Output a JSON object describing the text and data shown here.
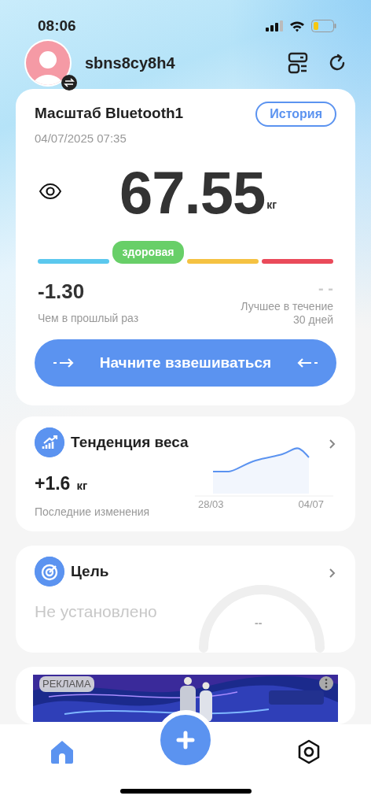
{
  "status_bar": {
    "time": "08:06"
  },
  "profile": {
    "username": "sbns8cy8h4"
  },
  "scale_card": {
    "title": "Масштаб Bluetooth1",
    "history_button": "История",
    "timestamp": "04/07/2025 07:35",
    "weight": "67.55",
    "unit": "кг",
    "status_label": "здоровая",
    "segments": [
      {
        "color": "#5bc8ee",
        "selected": false
      },
      {
        "color": "#68cf68",
        "selected": true
      },
      {
        "color": "#f5c242",
        "selected": false
      },
      {
        "color": "#ea4a5a",
        "selected": false
      }
    ],
    "change": "-1.30",
    "change_label": "Чем в прошлый раз",
    "best": "- -",
    "best_label": "Лучшее в течение 30 дней",
    "weigh_button": "Начните взвешиваться"
  },
  "trend_card": {
    "title": "Тенденция веса",
    "value": "+1.6",
    "unit": "кг",
    "label": "Последние изменения",
    "x_start": "28/03",
    "x_end": "04/07"
  },
  "goal_card": {
    "title": "Цель",
    "value": "Не установлено",
    "gauge_value": "--"
  },
  "ad": {
    "badge": "РЕКЛАМА",
    "kind": "picture"
  },
  "nav": [
    {
      "kind": "home",
      "selected": true
    },
    {
      "kind": "settings",
      "selected": false
    }
  ]
}
